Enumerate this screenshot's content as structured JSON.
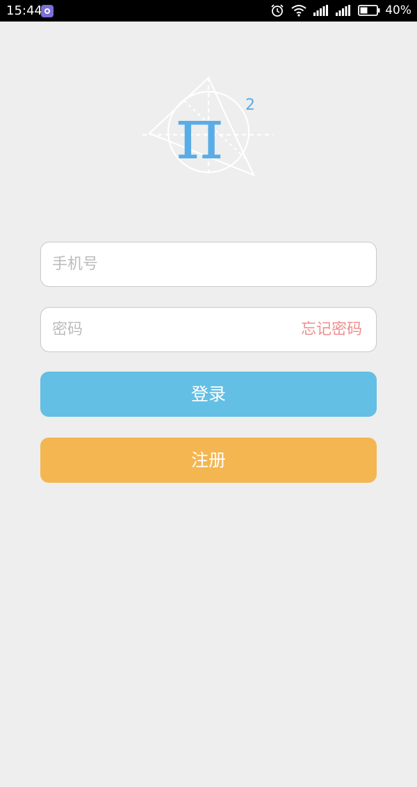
{
  "status_bar": {
    "time": "15:44",
    "battery_percent": "40%",
    "icons": [
      "app-notification-icon",
      "alarm-icon",
      "wifi-icon",
      "signal-icon",
      "signal-icon",
      "battery-icon"
    ]
  },
  "logo": {
    "symbol": "π",
    "superscript": "2",
    "color": "#5aace6"
  },
  "login_form": {
    "phone_placeholder": "手机号",
    "password_placeholder": "密码",
    "forgot_password_label": "忘记密码",
    "login_label": "登录",
    "register_label": "注册"
  },
  "colors": {
    "background": "#eeeeee",
    "login_button": "#63bfe4",
    "register_button": "#f4b650",
    "forgot_link": "#ef8e8e"
  }
}
